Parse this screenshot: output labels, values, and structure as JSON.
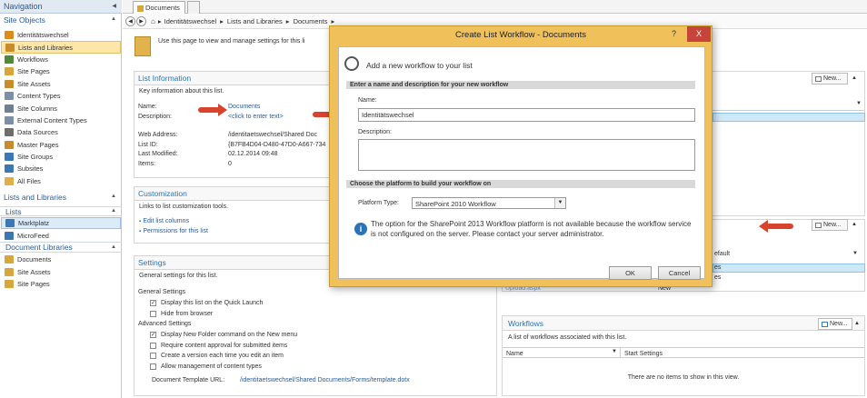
{
  "nav": {
    "title": "Navigation",
    "site_objects_label": "Site Objects",
    "site_objects": [
      {
        "label": "Identitätswechsel",
        "icon": "site-icon",
        "color": "#d98c1c"
      },
      {
        "label": "Lists and Libraries",
        "icon": "lists-icon",
        "color": "#c88d2a"
      },
      {
        "label": "Workflows",
        "icon": "workflow-icon",
        "color": "#4f8a3a"
      },
      {
        "label": "Site Pages",
        "icon": "pages-icon",
        "color": "#d9a63b"
      },
      {
        "label": "Site Assets",
        "icon": "assets-icon",
        "color": "#c88d2a"
      },
      {
        "label": "Content Types",
        "icon": "content-types-icon",
        "color": "#7b8fa8"
      },
      {
        "label": "Site Columns",
        "icon": "columns-icon",
        "color": "#6f7f95"
      },
      {
        "label": "External Content Types",
        "icon": "external-icon",
        "color": "#7b8fa8"
      },
      {
        "label": "Data Sources",
        "icon": "data-sources-icon",
        "color": "#6d6d6d"
      },
      {
        "label": "Master Pages",
        "icon": "master-pages-icon",
        "color": "#c88d2a"
      },
      {
        "label": "Site Groups",
        "icon": "groups-icon",
        "color": "#3b77b5"
      },
      {
        "label": "Subsites",
        "icon": "subsites-icon",
        "color": "#3b77b5"
      },
      {
        "label": "All Files",
        "icon": "folder-icon",
        "color": "#e0b046"
      }
    ],
    "lists_and_libraries_label": "Lists and Libraries",
    "lists_label": "Lists",
    "lists": [
      {
        "label": "Marktplatz",
        "icon": "list-icon",
        "color": "#3b77b5"
      },
      {
        "label": "MicroFeed",
        "icon": "list-icon",
        "color": "#3b77b5"
      }
    ],
    "doc_libs_label": "Document Libraries",
    "doc_libs": [
      {
        "label": "Documents",
        "icon": "library-icon",
        "color": "#d9a63b"
      },
      {
        "label": "Site Assets",
        "icon": "library-icon",
        "color": "#d9a63b"
      },
      {
        "label": "Site Pages",
        "icon": "library-icon",
        "color": "#d9a63b"
      }
    ]
  },
  "tabs": {
    "active": "Documents"
  },
  "breadcrumb": [
    "Identitätswechsel",
    "Lists and Libraries",
    "Documents"
  ],
  "intro": "Use this page to view and manage settings for this li",
  "list_info": {
    "heading": "List Information",
    "desc": "Key information about this list.",
    "rows": [
      {
        "k": "Name:",
        "v": "Documents"
      },
      {
        "k": "Description:",
        "v": "<click to enter text>"
      },
      {
        "k": "Web Address:",
        "v": "/identitaetswechsel/Shared Doc"
      },
      {
        "k": "List ID:",
        "v": "{B7FB4D04-D480-47D0-A667-734"
      },
      {
        "k": "Last Modified:",
        "v": "02.12.2014 09:48"
      },
      {
        "k": "Items:",
        "v": "0"
      }
    ]
  },
  "customization": {
    "heading": "Customization",
    "desc": "Links to list customization tools.",
    "links": [
      "Edit list columns",
      "Permissions for this list"
    ]
  },
  "settings": {
    "heading": "Settings",
    "desc": "General settings for this list.",
    "general_label": "General Settings",
    "general": [
      {
        "label": "Display this list on the Quick Launch",
        "checked": true
      },
      {
        "label": "Hide from browser",
        "checked": false
      }
    ],
    "advanced_label": "Advanced Settings",
    "advanced": [
      {
        "label": "Display New Folder command on the New menu",
        "checked": true
      },
      {
        "label": "Require content approval for submitted items",
        "checked": false
      },
      {
        "label": "Create a version each time you edit an item",
        "checked": false
      },
      {
        "label": "Allow management of content types",
        "checked": false
      }
    ],
    "template_label": "Document Template URL:",
    "template_value": "/identitaetswechsel/Shared Documents/Forms/template.dotx"
  },
  "right": {
    "new_label": "New...",
    "default_frag": "efault",
    "es_frag1": "es",
    "es_frag2": "es",
    "upload_frag": "Upload.aspx",
    "new_frag": "New",
    "workflows_heading": "Workflows",
    "workflows_desc": "A list of workflows associated with this list.",
    "col_name": "Name",
    "col_start": "Start Settings",
    "empty": "There are no items to show in this view."
  },
  "dialog": {
    "title": "Create List Workflow - Documents",
    "help": "?",
    "close": "X",
    "header": "Add a new workflow to your list",
    "sec1": "Enter a name and description for your new workflow",
    "name_label": "Name:",
    "name_value": "Identitätswechsel",
    "desc_label": "Description:",
    "desc_value": "",
    "sec2": "Choose the platform to build your workflow on",
    "platform_label": "Platform Type:",
    "platform_value": "SharePoint 2010 Workflow",
    "info": "The option for the SharePoint 2013 Workflow platform is not available because the workflow service is not configured on the server. Please contact your server administrator.",
    "ok": "OK",
    "cancel": "Cancel"
  },
  "colors": {
    "accent": "#2a74b7",
    "dialog_frame": "#f0c05a",
    "arrow": "#d8432e",
    "close": "#c7443a"
  }
}
